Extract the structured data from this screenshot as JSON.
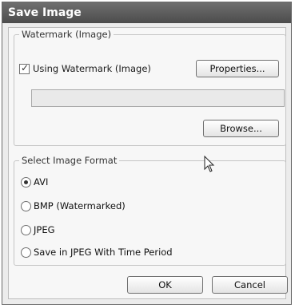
{
  "window": {
    "title": "Save Image"
  },
  "watermark_group": {
    "legend": "Watermark (Image)",
    "checkbox_label": "Using Watermark (Image)",
    "checkbox_checked": true,
    "properties_button": "Properties...",
    "path_value": "",
    "browse_button": "Browse..."
  },
  "format_group": {
    "legend": "Select Image Format",
    "options": [
      {
        "label": "AVI",
        "selected": true
      },
      {
        "label": "BMP (Watermarked)",
        "selected": false
      },
      {
        "label": "JPEG",
        "selected": false
      },
      {
        "label": "Save in JPEG With Time Period",
        "selected": false
      }
    ]
  },
  "footer": {
    "ok_button": "OK",
    "cancel_button": "Cancel"
  },
  "icons": {
    "checkbox": "check-icon",
    "cursor": "mouse-pointer-icon"
  }
}
